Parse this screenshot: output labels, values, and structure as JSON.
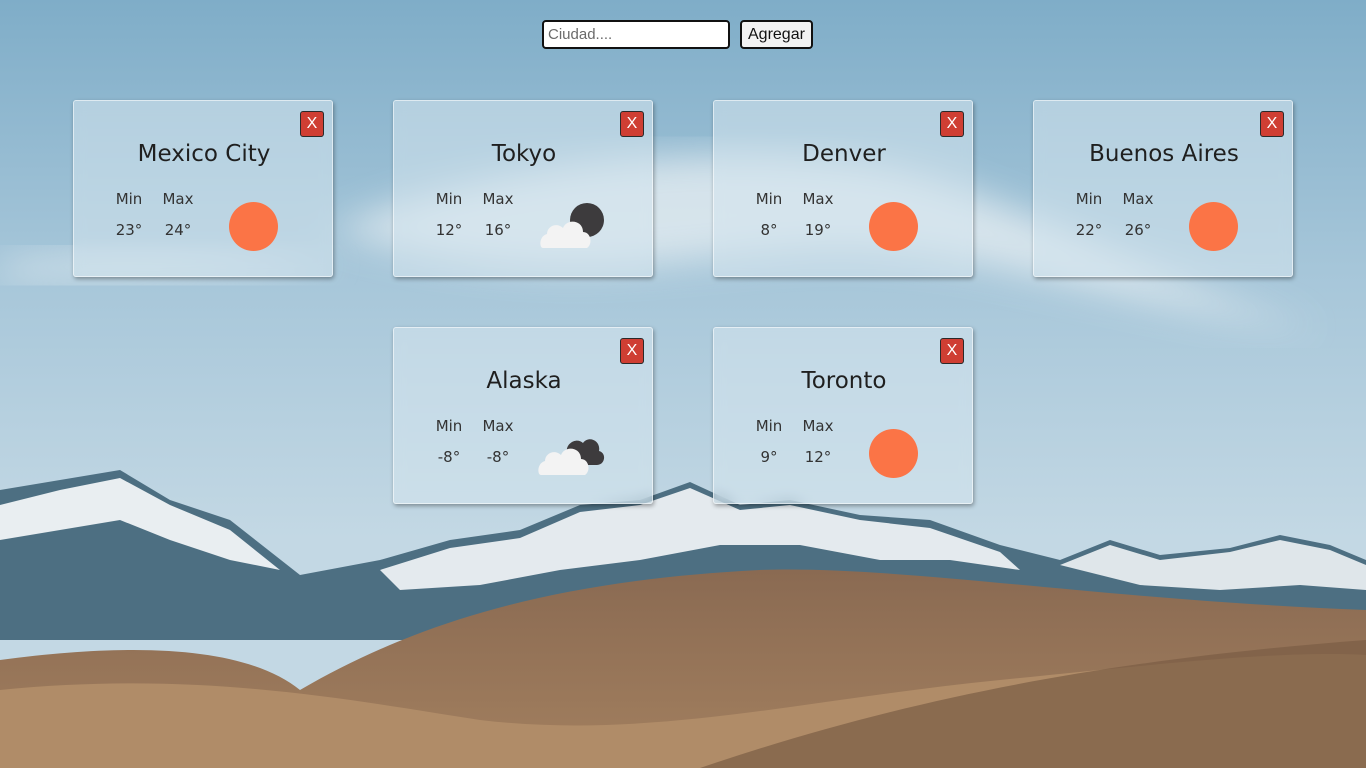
{
  "search": {
    "placeholder": "Ciudad....",
    "value": "",
    "add_label": "Agregar"
  },
  "cards": [
    {
      "city": "Mexico City",
      "min_label": "Min",
      "max_label": "Max",
      "min": "23°",
      "max": "24°",
      "close_label": "X",
      "icon": "sun-icon"
    },
    {
      "city": "Tokyo",
      "min_label": "Min",
      "max_label": "Max",
      "min": "12°",
      "max": "16°",
      "close_label": "X",
      "icon": "cloud-night-icon"
    },
    {
      "city": "Denver",
      "min_label": "Min",
      "max_label": "Max",
      "min": "8°",
      "max": "19°",
      "close_label": "X",
      "icon": "sun-icon"
    },
    {
      "city": "Buenos Aires",
      "min_label": "Min",
      "max_label": "Max",
      "min": "22°",
      "max": "26°",
      "close_label": "X",
      "icon": "sun-icon"
    },
    {
      "city": "Alaska",
      "min_label": "Min",
      "max_label": "Max",
      "min": "-8°",
      "max": "-8°",
      "close_label": "X",
      "icon": "cloudy-night-icon"
    },
    {
      "city": "Toronto",
      "min_label": "Min",
      "max_label": "Max",
      "min": "9°",
      "max": "12°",
      "close_label": "X",
      "icon": "sun-icon"
    }
  ],
  "colors": {
    "sun": "#fb7446",
    "close_button": "#cf3e33",
    "cloud": "#f3f3f3",
    "moon": "#3d3b3d"
  }
}
